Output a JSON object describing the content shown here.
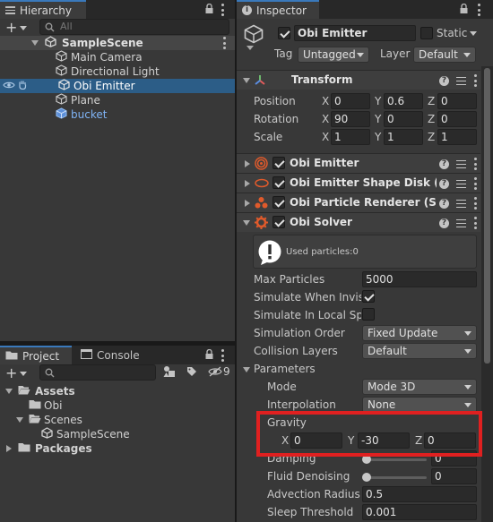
{
  "hierarchy": {
    "tab_label": "Hierarchy",
    "search_placeholder": "All",
    "scene_name": "SampleScene",
    "items": [
      {
        "label": "Main Camera"
      },
      {
        "label": "Directional Light"
      },
      {
        "label": "Obi Emitter"
      },
      {
        "label": "Plane"
      },
      {
        "label": "bucket"
      }
    ]
  },
  "project": {
    "tab_project": "Project",
    "tab_console": "Console",
    "hidden_count": "9",
    "tree": {
      "assets": "Assets",
      "obi": "Obi",
      "scenes": "Scenes",
      "sample_scene": "SampleScene",
      "packages": "Packages"
    }
  },
  "inspector": {
    "tab_label": "Inspector",
    "object_name": "Obi Emitter",
    "static_label": "Static",
    "tag_label": "Tag",
    "tag_value": "Untagged",
    "layer_label": "Layer",
    "layer_value": "Default",
    "transform": {
      "title": "Transform",
      "position_label": "Position",
      "rotation_label": "Rotation",
      "scale_label": "Scale",
      "axis_x": "X",
      "axis_y": "Y",
      "axis_z": "Z",
      "position": {
        "x": "0",
        "y": "0.6",
        "z": "0"
      },
      "rotation": {
        "x": "90",
        "y": "0",
        "z": "0"
      },
      "scale": {
        "x": "1",
        "y": "1",
        "z": "1"
      }
    },
    "components": [
      {
        "title": "Obi Emitter"
      },
      {
        "title": "Obi Emitter Shape Disk (S"
      },
      {
        "title": "Obi Particle Renderer (Sc"
      },
      {
        "title": "Obi Solver"
      }
    ],
    "solver": {
      "used_particles": "Used particles:0",
      "max_particles_label": "Max Particles",
      "max_particles_value": "5000",
      "simulate_invisible_label": "Simulate When Invisil",
      "simulate_local_label": "Simulate In Local Spa",
      "simulation_order_label": "Simulation Order",
      "simulation_order_value": "Fixed Update",
      "collision_layers_label": "Collision Layers",
      "collision_layers_value": "Default",
      "parameters_label": "Parameters",
      "mode_label": "Mode",
      "mode_value": "Mode 3D",
      "interpolation_label": "Interpolation",
      "interpolation_value": "None",
      "gravity_label": "Gravity",
      "gravity": {
        "x": "0",
        "y": "-30",
        "z": "0"
      },
      "damping_label": "Damping",
      "damping_value": "0",
      "fluid_denoising_label": "Fluid Denoising",
      "fluid_denoising_value": "0",
      "advection_radius_label": "Advection Radius",
      "advection_radius_value": "0.5",
      "sleep_threshold_label": "Sleep Threshold",
      "sleep_threshold_value": "0.001"
    }
  },
  "colors": {
    "selection": "#2c5d87",
    "tab_accent": "#3a79bb",
    "highlight_box": "#e02020",
    "prefab_blue": "#7fb3f5"
  }
}
